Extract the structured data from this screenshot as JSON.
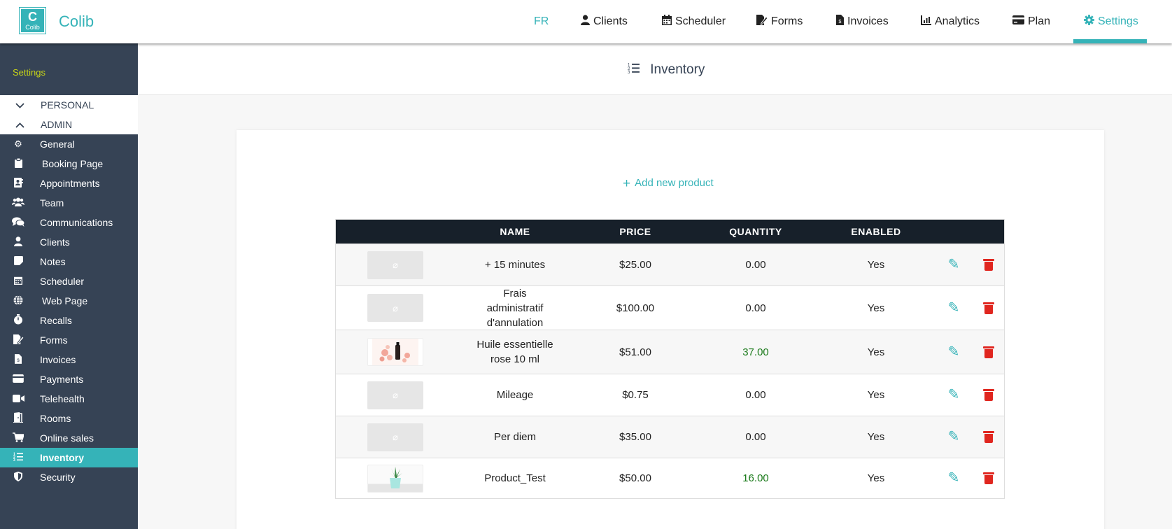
{
  "app": {
    "brand": "Colib",
    "logo_text": "Colib",
    "logo_glyph": "C"
  },
  "topnav": {
    "lang": "FR",
    "items": [
      {
        "label": "Clients",
        "icon": "user-icon"
      },
      {
        "label": "Scheduler",
        "icon": "calendar-icon"
      },
      {
        "label": "Forms",
        "icon": "form-icon"
      },
      {
        "label": "Invoices",
        "icon": "invoice-icon"
      },
      {
        "label": "Analytics",
        "icon": "chart-icon"
      },
      {
        "label": "Plan",
        "icon": "credit-card-icon"
      },
      {
        "label": "Settings",
        "icon": "gear-icon"
      }
    ],
    "active": "Settings"
  },
  "sidebar": {
    "title": "Settings",
    "sections": [
      {
        "label": "PERSONAL",
        "icon": "chevron-down-icon"
      },
      {
        "label": "ADMIN",
        "icon": "chevron-up-icon"
      }
    ],
    "items": [
      {
        "label": "General",
        "icon": "gear-icon"
      },
      {
        "label": "Booking Page",
        "icon": "clipboard-icon"
      },
      {
        "label": "Appointments",
        "icon": "address-book-icon"
      },
      {
        "label": "Team",
        "icon": "users-icon"
      },
      {
        "label": "Communications",
        "icon": "comments-icon"
      },
      {
        "label": "Clients",
        "icon": "user-icon"
      },
      {
        "label": "Notes",
        "icon": "note-icon"
      },
      {
        "label": "Scheduler",
        "icon": "calendar-icon"
      },
      {
        "label": "Web Page",
        "icon": "globe-icon"
      },
      {
        "label": "Recalls",
        "icon": "stopwatch-icon"
      },
      {
        "label": "Forms",
        "icon": "form-icon"
      },
      {
        "label": "Invoices",
        "icon": "invoice-icon"
      },
      {
        "label": "Payments",
        "icon": "credit-card-icon"
      },
      {
        "label": "Telehealth",
        "icon": "video-icon"
      },
      {
        "label": "Rooms",
        "icon": "door-icon"
      },
      {
        "label": "Online sales",
        "icon": "cart-icon"
      },
      {
        "label": "Inventory",
        "icon": "list-ordered-icon"
      },
      {
        "label": "Security",
        "icon": "shield-icon"
      }
    ],
    "active": "Inventory"
  },
  "page": {
    "title": "Inventory",
    "add_label": "Add new product"
  },
  "table": {
    "headers": {
      "name": "NAME",
      "price": "PRICE",
      "quantity": "QUANTITY",
      "enabled": "ENABLED"
    },
    "rows": [
      {
        "name": "+ 15 minutes",
        "price": "$25.00",
        "quantity": "0.00",
        "enabled": "Yes",
        "image": "no-image"
      },
      {
        "name": "Frais administratif d'annulation",
        "price": "$100.00",
        "quantity": "0.00",
        "enabled": "Yes",
        "image": "no-image"
      },
      {
        "name": "Huile essentielle rose 10 ml",
        "price": "$51.00",
        "quantity": "37.00",
        "enabled": "Yes",
        "image": "photo-rose-oil"
      },
      {
        "name": "Mileage",
        "price": "$0.75",
        "quantity": "0.00",
        "enabled": "Yes",
        "image": "no-image"
      },
      {
        "name": "Per diem",
        "price": "$35.00",
        "quantity": "0.00",
        "enabled": "Yes",
        "image": "no-image"
      },
      {
        "name": "Product_Test",
        "price": "$50.00",
        "quantity": "16.00",
        "enabled": "Yes",
        "image": "photo-plant"
      }
    ]
  },
  "colors": {
    "accent": "#35b3b8",
    "sidebar": "#364355",
    "table_header": "#17202a",
    "danger": "#e0261f",
    "stock_green": "#1a7a1a"
  }
}
